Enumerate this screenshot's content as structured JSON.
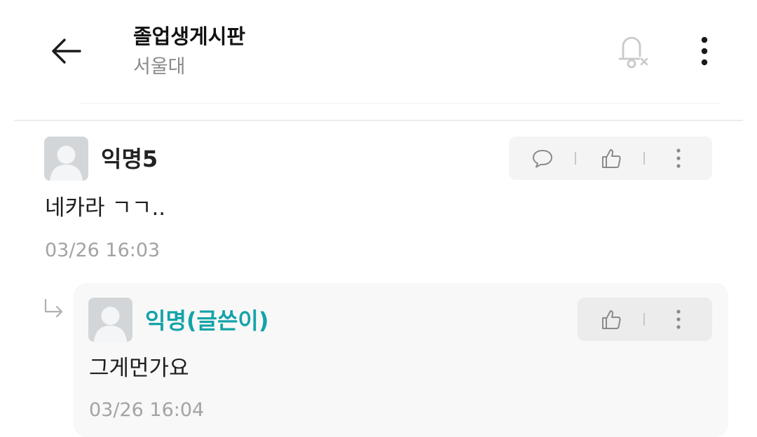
{
  "header": {
    "title": "졸업생게시판",
    "subtitle": "서울대",
    "icons": [
      "back-arrow-icon",
      "bell-off-icon",
      "more-vertical-icon"
    ]
  },
  "comments": [
    {
      "author": "익명5",
      "text": "네카라 ㄱㄱ..",
      "time": "03/26 16:03",
      "actions": [
        "reply-icon",
        "thumbs-up-icon",
        "more-icon"
      ],
      "replies": [
        {
          "author": "익명(글쓴이)",
          "author_color": "#13a3a8",
          "text": "그게먼가요",
          "time": "03/26 16:04",
          "actions": [
            "thumbs-up-icon",
            "more-icon"
          ]
        }
      ]
    }
  ],
  "colors": {
    "background": "#ffffff",
    "muted_text": "#a3a3a3",
    "author_highlight": "#13a3a8",
    "reply_background": "#f8f8f8"
  }
}
